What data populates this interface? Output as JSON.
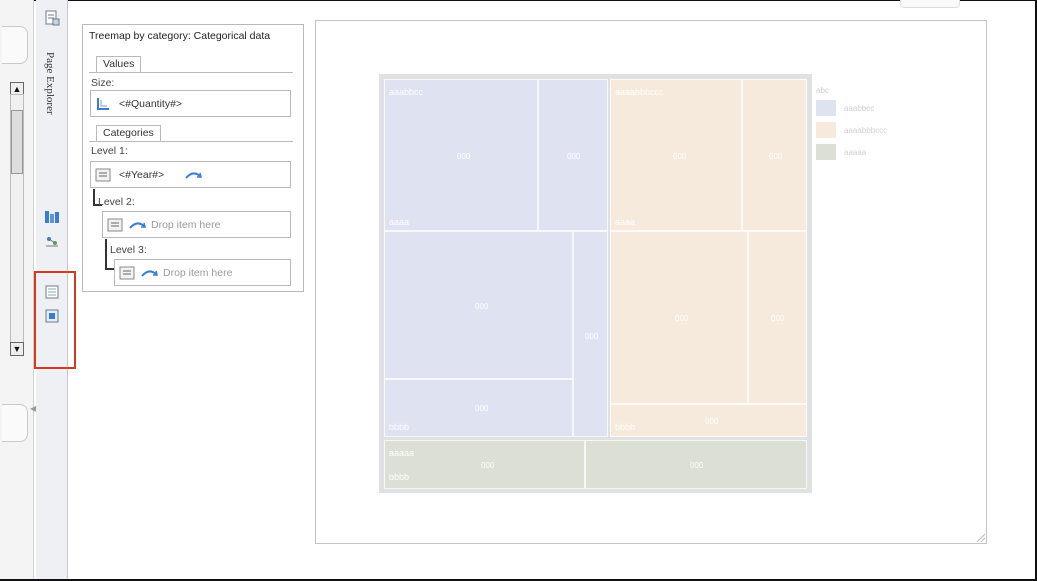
{
  "sidebar": {
    "page_explorer_label": "Page Explorer"
  },
  "panel": {
    "title": "Treemap by category: Categorical data",
    "values_group": "Values",
    "size_label": "Size:",
    "size_value": "<#Quantity#>",
    "categories_group": "Categories",
    "level1_label": "Level 1:",
    "level1_value": "<#Year#>",
    "level2_label": "Level 2:",
    "level2_placeholder": "Drop item here",
    "level3_label": "Level 3:",
    "level3_placeholder": "Drop item here"
  },
  "treemap": {
    "groups": [
      {
        "label": "aaabbcc",
        "footer": "aaaa",
        "color": "#dfe3f1"
      },
      {
        "label": "aaaabbbccc",
        "footer": "aaaa",
        "color": "#f6eadd"
      },
      {
        "label": "aaaaa",
        "footer": "bbbb",
        "color": "#dcdfd4"
      }
    ],
    "blue_lower_footer": "bbbb",
    "peach_lower_footer": "bbbb",
    "cell_value": "000"
  },
  "legend": {
    "title": "abc",
    "items": [
      {
        "label": "aaabbcc",
        "color": "#dfe3f1"
      },
      {
        "label": "aaaabbbccc",
        "color": "#f6eadd"
      },
      {
        "label": "aaaaa",
        "color": "#dcdfd4"
      }
    ]
  },
  "colors": {
    "highlight": "#d9381e",
    "accent_blue": "#3a7bd5"
  }
}
